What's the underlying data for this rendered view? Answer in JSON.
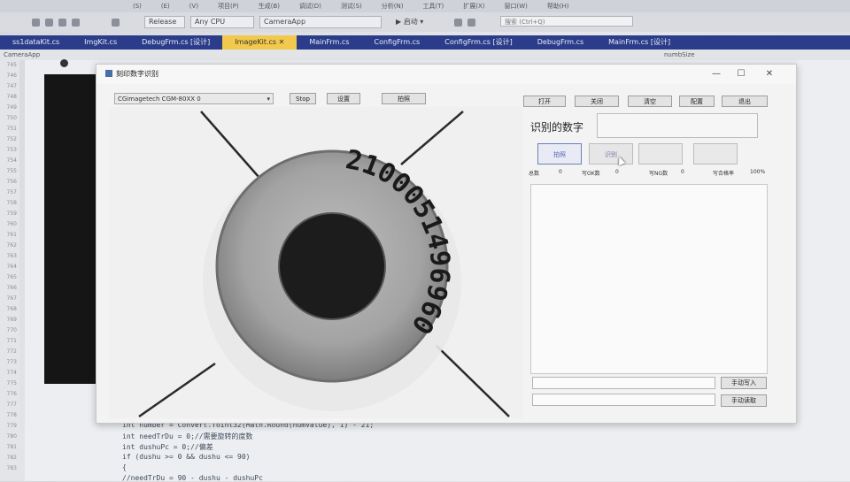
{
  "ide": {
    "menu": [
      "(S)",
      "(E)",
      "(V)",
      "项目(P)",
      "生成(B)",
      "调试(D)",
      "测试(S)",
      "分析(N)",
      "工具(T)",
      "扩展(X)",
      "窗口(W)",
      "帮助(H)"
    ],
    "toolbar": {
      "configuration": "Release",
      "platform": "Any CPU",
      "project": "CameraApp",
      "run_label": "▶ 启动 ▾",
      "search_placeholder": "搜索 (Ctrl+Q)"
    },
    "tabs": [
      {
        "label": "ss1dataKit.cs"
      },
      {
        "label": "ImgKit.cs"
      },
      {
        "label": "DebugFrm.cs [设计]"
      },
      {
        "label": "ImageKit.cs  ✕"
      },
      {
        "label": "MainFrm.cs"
      },
      {
        "label": "ConfigFrm.cs"
      },
      {
        "label": "ConfigFrm.cs [设计]"
      },
      {
        "label": "DebugFrm.cs"
      },
      {
        "label": "MainFrm.cs [设计]"
      }
    ],
    "sub_left": "CameraApp",
    "sub_right": "numbSize",
    "line_numbers": [
      "745",
      "746",
      "747",
      "748",
      "749",
      "750",
      "751",
      "752",
      "753",
      "754",
      "755",
      "756",
      "757",
      "758",
      "759",
      "760",
      "761",
      "762",
      "763",
      "764",
      "765",
      "766",
      "767",
      "768",
      "769",
      "770",
      "771",
      "772",
      "773",
      "774",
      "775",
      "776",
      "777",
      "778",
      "779",
      "780",
      "781",
      "782",
      "783"
    ],
    "code_lines": [
      "int number = Convert.ToInt32(Math.Round(numValue), 1) - 21;",
      "int needTrDu = 0;//需要旋转的度数",
      "int dushuPc = 0;//偏差",
      "if (dushu >= 0 && dushu <= 90)",
      "{",
      "    //needTrDu = 90 - dushu - dushuPc"
    ]
  },
  "app": {
    "title": "刻印数字识别",
    "window_controls": {
      "minimize": "—",
      "maximize": "☐",
      "close": "✕"
    },
    "camera_combo": "CGimagetech CGM-80XX    0",
    "btn_stop": "Stop",
    "btn_settings": "设置",
    "btn_capture": "拍照",
    "btn_open": "打开",
    "btn_close": "关闭",
    "btn_clear": "清空",
    "btn_config": "配置",
    "btn_exit": "退出",
    "digits_label": "识别的数字",
    "digits_value": "",
    "big_buttons": [
      "拍照",
      "识别",
      "",
      ""
    ],
    "stats": [
      {
        "label": "总数",
        "value": "0"
      },
      {
        "label": "写OK数",
        "value": "0"
      },
      {
        "label": "写NG数",
        "value": "0"
      },
      {
        "label": "写合格率",
        "value": "100%"
      }
    ],
    "btn_manual_write": "手动写入",
    "btn_manual_read": "手动读取",
    "coin_digits": "2100051496960"
  }
}
